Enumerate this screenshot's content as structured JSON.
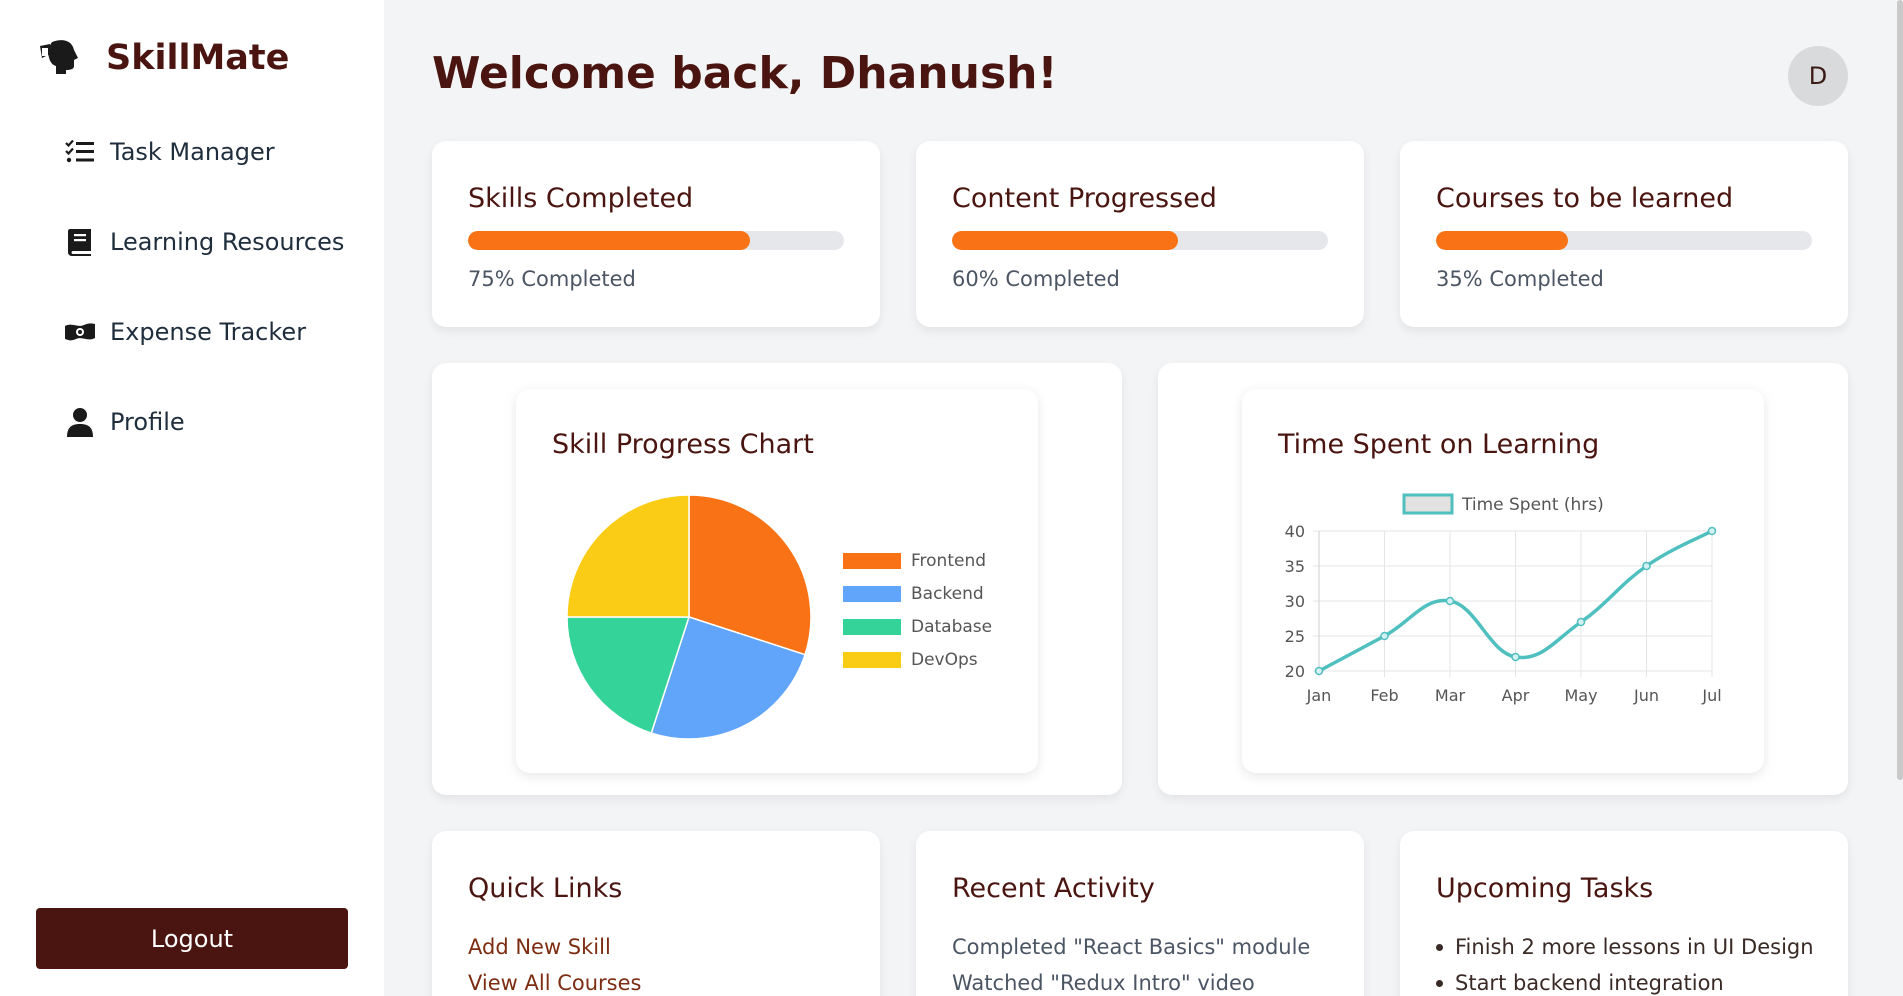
{
  "sidebar": {
    "brand": "SkillMate",
    "items": [
      {
        "label": "Task Manager",
        "icon": "task-list-icon"
      },
      {
        "label": "Learning Resources",
        "icon": "book-icon"
      },
      {
        "label": "Expense Tracker",
        "icon": "money-icon"
      },
      {
        "label": "Profile",
        "icon": "user-icon"
      }
    ],
    "logout": "Logout"
  },
  "header": {
    "welcome": "Welcome back, Dhanush!",
    "avatar_initial": "D"
  },
  "stats": [
    {
      "title": "Skills Completed",
      "progress": 75,
      "label": "75% Completed"
    },
    {
      "title": "Content Progressed",
      "progress": 60,
      "label": "60% Completed"
    },
    {
      "title": "Courses to be learned",
      "progress": 35,
      "label": "35% Completed"
    }
  ],
  "colors": {
    "accent": "#f97316",
    "brand": "#4a1510",
    "frontend": "#f97316",
    "backend": "#60a5fa",
    "database": "#34d399",
    "devops": "#facc15",
    "line": "#4fbfbf"
  },
  "chart_data": [
    {
      "type": "pie",
      "title": "Skill Progress Chart",
      "categories": [
        "Frontend",
        "Backend",
        "Database",
        "DevOps"
      ],
      "values": [
        30,
        25,
        20,
        25
      ],
      "legend": "right"
    },
    {
      "type": "line",
      "title": "Time Spent on Learning",
      "categories": [
        "Jan",
        "Feb",
        "Mar",
        "Apr",
        "May",
        "Jun",
        "Jul"
      ],
      "series": [
        {
          "name": "Time Spent (hrs)",
          "values": [
            20,
            25,
            30,
            22,
            27,
            35,
            40
          ]
        }
      ],
      "yticks": [
        "20",
        "25",
        "30",
        "35",
        "40"
      ],
      "ylim": [
        20,
        40
      ],
      "grid": true,
      "legend": "top"
    }
  ],
  "quick_links": {
    "title": "Quick Links",
    "items": [
      "Add New Skill",
      "View All Courses"
    ]
  },
  "recent_activity": {
    "title": "Recent Activity",
    "items": [
      "Completed \"React Basics\" module",
      "Watched \"Redux Intro\" video"
    ]
  },
  "upcoming_tasks": {
    "title": "Upcoming Tasks",
    "items": [
      "Finish 2 more lessons in UI Design",
      "Start backend integration"
    ]
  }
}
